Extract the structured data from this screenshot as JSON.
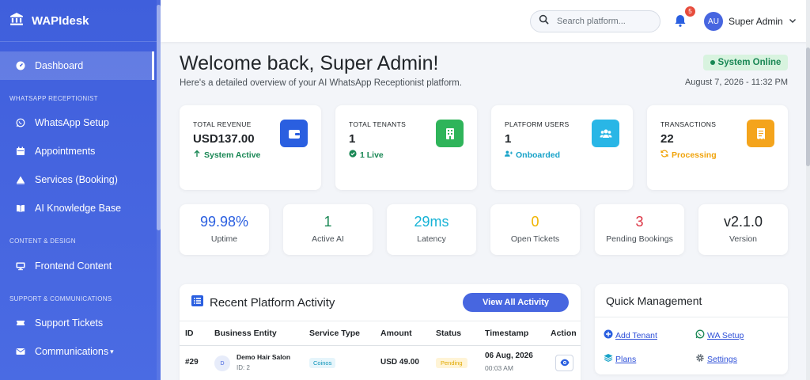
{
  "sidebar": {
    "brand": "WAPIdesk",
    "active_item": "Dashboard",
    "sections": [
      "WhatsApp Receptionist",
      "Content & Design",
      "Support & Communications"
    ],
    "items": [
      {
        "label": "WhatsApp Setup",
        "icon": "whatsapp-icon"
      },
      {
        "label": "Appointments",
        "icon": "calendar-icon"
      },
      {
        "label": "Services (Booking)",
        "icon": "warning-triangle-icon"
      },
      {
        "label": "AI Knowledge Base",
        "icon": "book-icon"
      },
      {
        "label": "Frontend Content",
        "icon": "monitor-icon"
      },
      {
        "label": "Support Tickets",
        "icon": "ticket-icon"
      },
      {
        "label": "Communications",
        "icon": "envelope-icon",
        "caret": "▾"
      }
    ]
  },
  "topbar": {
    "search_placeholder": "Search platform...",
    "notification_count": "5",
    "user_initials": "AU",
    "user_name": "Super Admin"
  },
  "header": {
    "title": "Welcome back, Super Admin!",
    "subtitle": "Here's a detailed overview of your AI WhatsApp Receptionist platform.",
    "status": "System Online",
    "datetime": "August 7, 2026 - 11:32 PM"
  },
  "stats": [
    {
      "label": "Total Revenue",
      "value": "USD137.00",
      "note": "System Active",
      "note_color": "#198754",
      "tile_color": "#2a5fe0",
      "icon": "wallet-icon"
    },
    {
      "label": "Total Tenants",
      "value": "1",
      "note": "1 Live",
      "note_color": "#198754",
      "tile_color": "#2fb45a",
      "icon": "building-icon"
    },
    {
      "label": "Platform Users",
      "value": "1",
      "note": "Onboarded",
      "note_color": "#17a2c8",
      "tile_color": "#29b6e6",
      "icon": "users-icon"
    },
    {
      "label": "Transactions",
      "value": "22",
      "note": "Processing",
      "note_color": "#f0a30a",
      "tile_color": "#f4a41c",
      "icon": "receipt-icon"
    }
  ],
  "metrics": [
    {
      "value": "99.98%",
      "label": "Uptime",
      "color": "#2a5fe0"
    },
    {
      "value": "1",
      "label": "Active AI",
      "color": "#198754"
    },
    {
      "value": "29ms",
      "label": "Latency",
      "color": "#17b3d6"
    },
    {
      "value": "0",
      "label": "Open Tickets",
      "color": "#f0b400"
    },
    {
      "value": "3",
      "label": "Pending Bookings",
      "color": "#dc3545"
    },
    {
      "value": "v2.1.0",
      "label": "Version",
      "color": "#212529"
    }
  ],
  "activity": {
    "title": "Recent Platform Activity",
    "view_all": "View All Activity",
    "columns": [
      "ID",
      "Business Entity",
      "Service Type",
      "Amount",
      "Status",
      "Timestamp",
      "Action"
    ],
    "rows": [
      {
        "id": "#29",
        "avatar": "D",
        "entity": "Demo Hair Salon",
        "entity_id": "ID: 2",
        "service": "Coinos",
        "amount": "USD 49.00",
        "status": "Pending",
        "date": "06 Aug, 2026",
        "time": "00:03 AM"
      }
    ]
  },
  "quick": {
    "title": "Quick Management",
    "links": [
      "Add Tenant",
      "WA Setup",
      "Plans",
      "Settings"
    ]
  }
}
